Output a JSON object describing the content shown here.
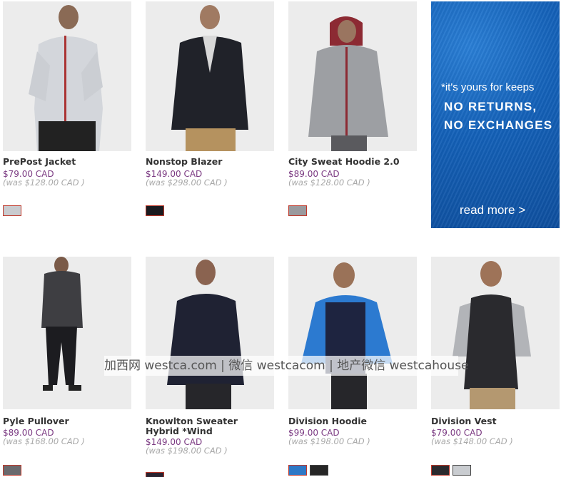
{
  "products": [
    {
      "name": "PrePost Jacket",
      "price": "$79.00 CAD",
      "was": "(was $128.00 CAD )",
      "swatches": [
        "#c9cbcf"
      ]
    },
    {
      "name": "Nonstop Blazer",
      "price": "$149.00 CAD",
      "was": "(was $298.00 CAD )",
      "swatches": [
        "#1a1a1f"
      ]
    },
    {
      "name": "City Sweat Hoodie 2.0",
      "price": "$89.00 CAD",
      "was": "(was $128.00 CAD )",
      "swatches": [
        "#9a9a9e"
      ]
    },
    {
      "name": "Pyle Pullover",
      "price": "$89.00 CAD",
      "was": "(was $168.00 CAD )",
      "swatches": [
        "#6a6a6e"
      ]
    },
    {
      "name": "Knowlton Sweater Hybrid *Wind",
      "price": "$149.00 CAD",
      "was": "(was $198.00 CAD )",
      "swatches": [
        "#2a2330"
      ]
    },
    {
      "name": "Division Hoodie",
      "price": "$99.00 CAD",
      "was": "(was $198.00 CAD )",
      "swatches": [
        "#2d78c6",
        "#262626"
      ]
    },
    {
      "name": "Division Vest",
      "price": "$79.00 CAD",
      "was": "(was $148.00 CAD )",
      "swatches": [
        "#2a2a2e",
        "#c9ccd0"
      ]
    }
  ],
  "promo": {
    "tagline": "*it's yours for keeps",
    "line1": "NO RETURNS,",
    "line2": "NO EXCHANGES",
    "link": "read more >"
  },
  "watermark": "加西网 westca.com | 微信 westcacom | 地产微信 westcahouse",
  "colors": {
    "price": "#7b3a82",
    "promo_blue": "#1461b8"
  }
}
